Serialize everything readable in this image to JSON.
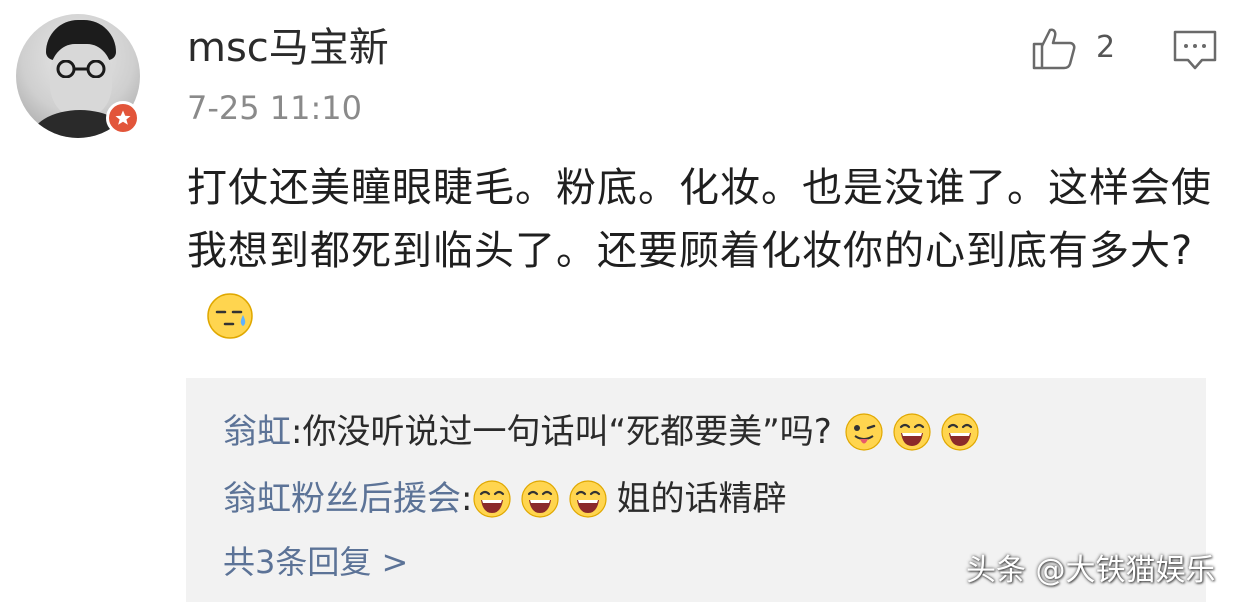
{
  "post": {
    "username": "msc马宝新",
    "timestamp": "7-25 11:10",
    "like_count": "2",
    "text": "打仗还美瞳眼睫毛。粉底。化妆。也是没谁了。这样会使我想到都死到临头了。还要顾着化妆你的心到底有多大?"
  },
  "replies": [
    {
      "author": "翁虹",
      "separator": ": ",
      "text": "你没听说过一句话叫“死都要美”吗?",
      "emojis": [
        "tongue-out-emoji",
        "laughing-emoji",
        "laughing-emoji"
      ]
    },
    {
      "author": "翁虹粉丝后援会",
      "separator": ": ",
      "text": "姐的话精辟",
      "emojis": [
        "laughing-emoji",
        "laughing-emoji",
        "laughing-emoji"
      ]
    }
  ],
  "more_replies_label": "共3条回复 >",
  "watermark": "头条 @大铁猫娱乐",
  "colors": {
    "reply_author": "#5c7397",
    "reply_background": "#f2f2f2",
    "badge": "#e2553a",
    "text": "#1f1f1f",
    "muted": "#8a8a8a"
  }
}
